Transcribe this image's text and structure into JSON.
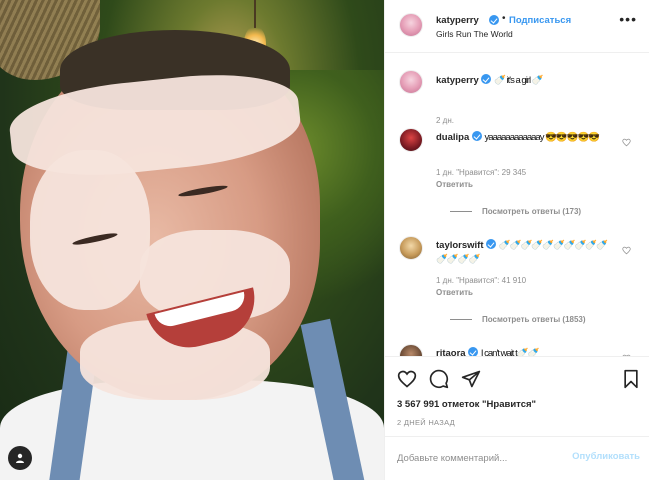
{
  "post": {
    "author": "katyperry",
    "follow_label": "Подписаться",
    "dot": "•",
    "location": "Girls Run The World",
    "more": "•••"
  },
  "caption": {
    "username": "katyperry",
    "text": "🍼 it's a girl 🍼",
    "time": "2 дн."
  },
  "comments": [
    {
      "username": "dualipa",
      "text": "yaaaaaaaaaaaay 😎😎😎😎😎",
      "meta": "1 дн.   \"Нравится\": 29 345",
      "reply_label": "Ответить",
      "view_replies": "Посмотреть ответы (173)"
    },
    {
      "username": "taylorswift",
      "text": "🍼🍼🍼🍼🍼🍼🍼🍼🍼🍼🍼🍼🍼🍼",
      "meta": "1 дн.   \"Нравится\": 41 910",
      "reply_label": "Ответить",
      "view_replies": "Посмотреть ответы (1853)"
    },
    {
      "username": "ritaora",
      "text": "I can't wait t🍼🍼"
    }
  ],
  "likes_text": "3 567 991 отметок \"Нравится\"",
  "date_text": "2 ДНЕЙ НАЗАД",
  "compose": {
    "placeholder": "Добавьте комментарий...",
    "post_label": "Опубликовать"
  },
  "colors": {
    "accent": "#3897f0",
    "muted": "#8e8e8e",
    "post_disabled": "#b2dffc"
  },
  "icons": [
    "heart-icon",
    "comment-icon",
    "share-icon",
    "bookmark-icon",
    "user-tag-icon",
    "more-icon",
    "verified-badge-icon"
  ]
}
